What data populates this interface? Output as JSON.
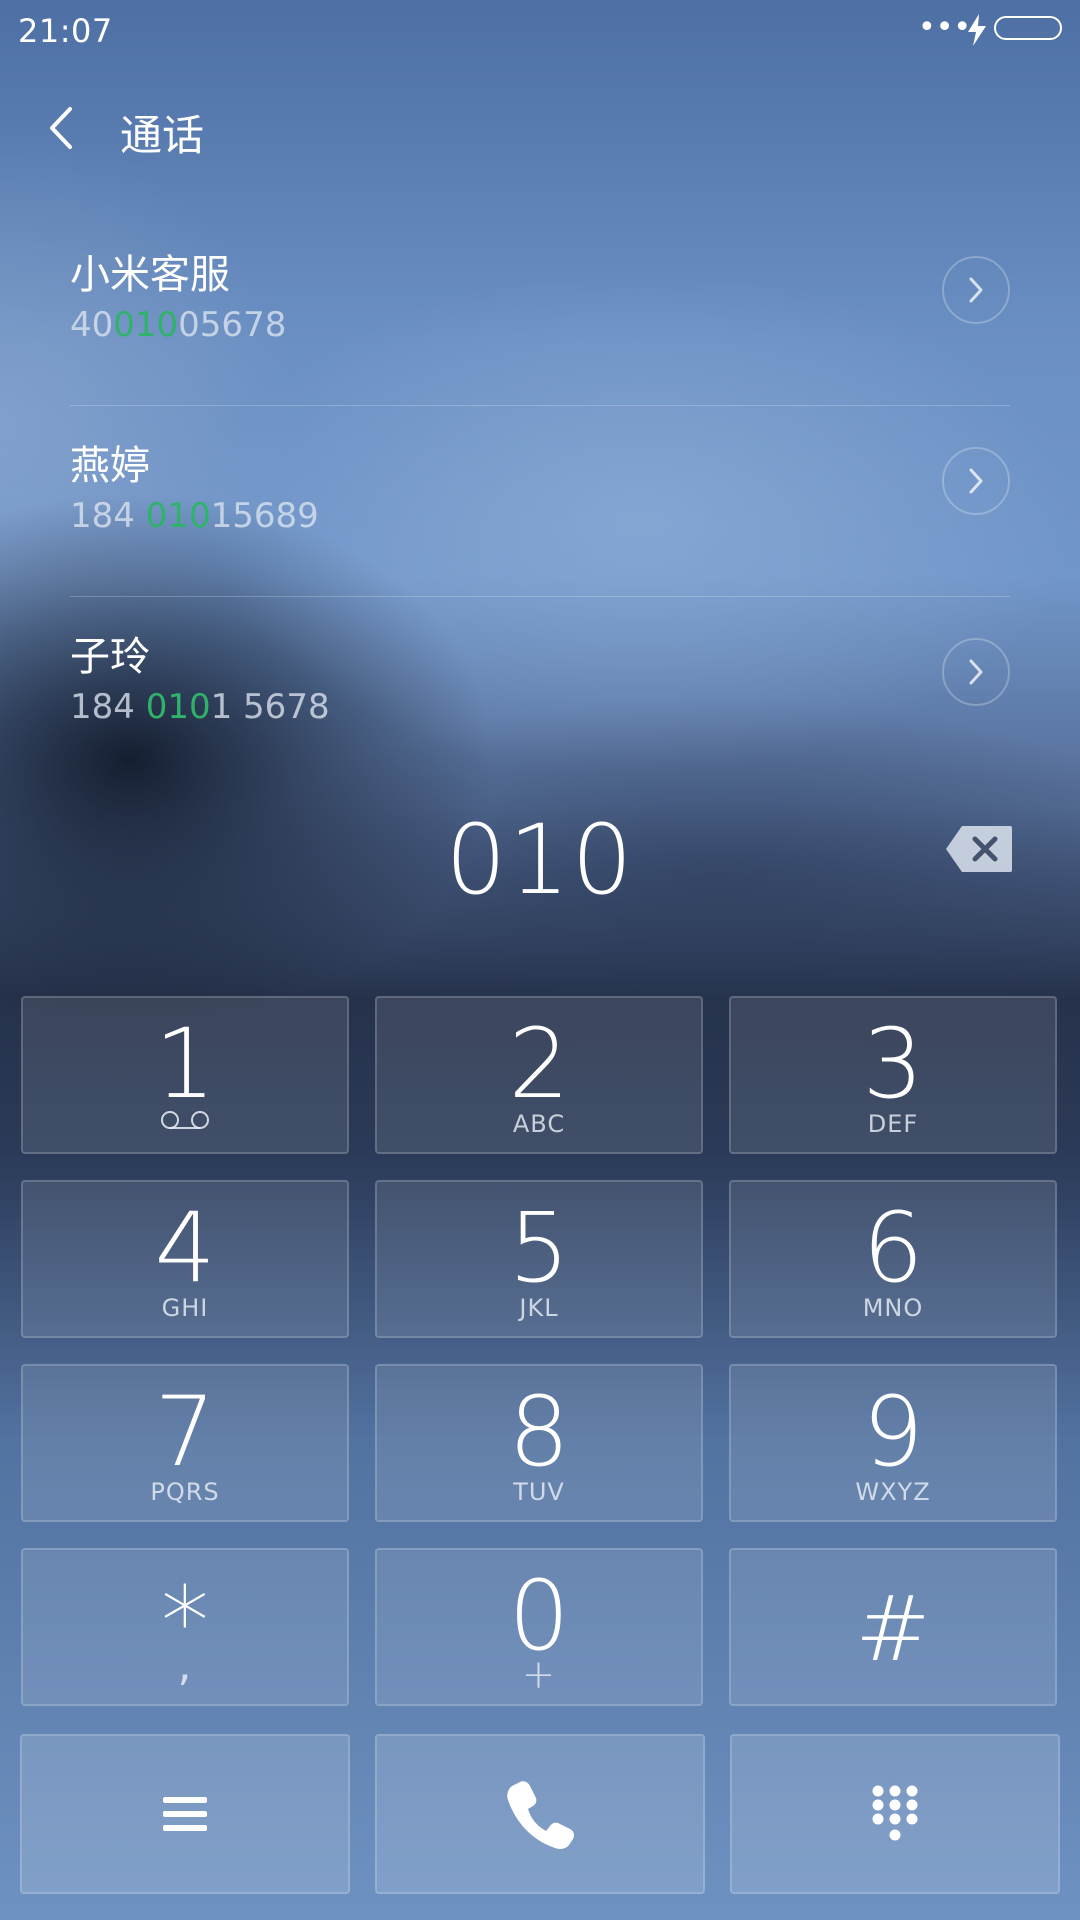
{
  "status_bar": {
    "time": "21:07",
    "dots": "•••"
  },
  "header": {
    "title": "通话"
  },
  "contacts": [
    {
      "name": "小米客服",
      "number_prefix": "40",
      "number_match": "010",
      "number_suffix": "05678"
    },
    {
      "name": "燕婷",
      "number_prefix": "184 ",
      "number_match": "010",
      "number_suffix": "15689"
    },
    {
      "name": "子玲",
      "number_prefix": "184 ",
      "number_match": "010",
      "number_suffix": "1 5678"
    }
  ],
  "dialer": {
    "number": "010"
  },
  "keypad": {
    "keys": [
      {
        "digit": "1",
        "letters": ""
      },
      {
        "digit": "2",
        "letters": "ABC"
      },
      {
        "digit": "3",
        "letters": "DEF"
      },
      {
        "digit": "4",
        "letters": "GHI"
      },
      {
        "digit": "5",
        "letters": "JKL"
      },
      {
        "digit": "6",
        "letters": "MNO"
      },
      {
        "digit": "7",
        "letters": "PQRS"
      },
      {
        "digit": "8",
        "letters": "TUV"
      },
      {
        "digit": "9",
        "letters": "WXYZ"
      },
      {
        "digit": "*",
        "letters": ","
      },
      {
        "digit": "0",
        "letters": "+"
      },
      {
        "digit": "#",
        "letters": ""
      }
    ]
  },
  "colors": {
    "match_highlight": "#2fb36a",
    "text": "#ffffff"
  },
  "icons": {
    "back": "chevron-left-icon",
    "detail": "chevron-right-icon",
    "backspace": "backspace-icon",
    "voicemail": "voicemail-icon",
    "menu": "menu-icon",
    "call": "phone-icon",
    "dialpad": "dialpad-icon",
    "charging": "lightning-icon",
    "battery": "battery-icon"
  }
}
